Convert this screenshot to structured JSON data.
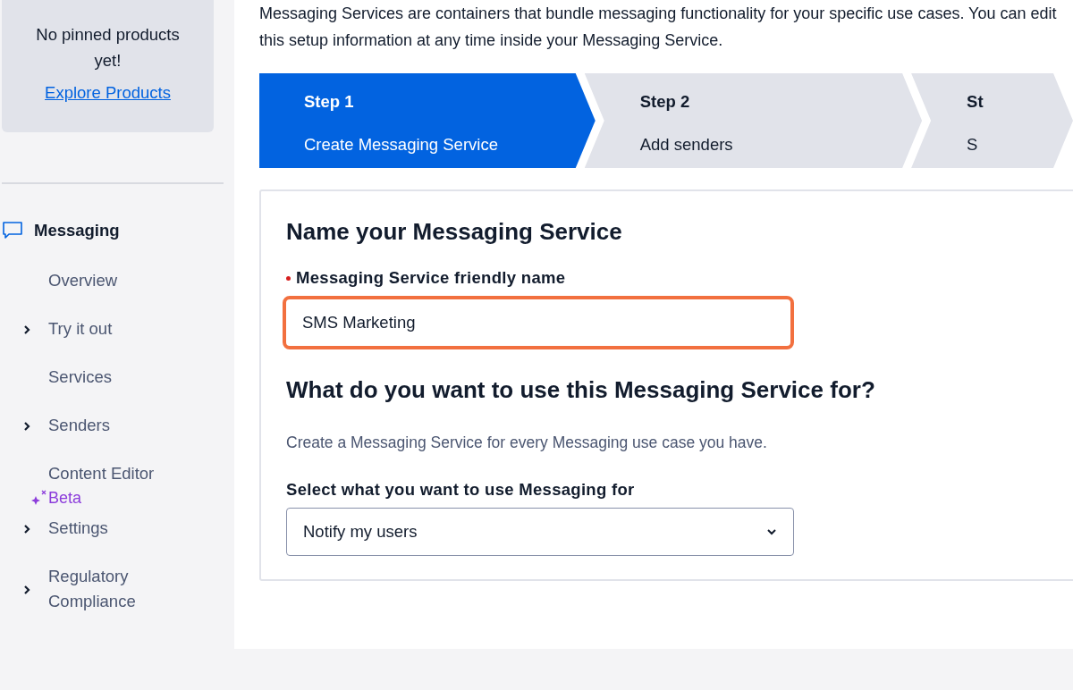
{
  "pinned": {
    "message": "No pinned products yet!",
    "link": "Explore Products"
  },
  "sidebar": {
    "section": "Messaging",
    "items": [
      {
        "label": "Overview",
        "expandable": false
      },
      {
        "label": "Try it out",
        "expandable": true
      },
      {
        "label": "Services",
        "expandable": false
      },
      {
        "label": "Senders",
        "expandable": true
      },
      {
        "label": "Content Editor",
        "expandable": false,
        "badge": "Beta"
      },
      {
        "label": "Settings",
        "expandable": true
      },
      {
        "label": "Regulatory Compliance",
        "expandable": true
      }
    ]
  },
  "intro": "Messaging Services are containers that bundle messaging functionality for your specific use cases. You can edit this setup information at any time inside your Messaging Service.",
  "steps": [
    {
      "title": "Step 1",
      "subtitle": "Create Messaging Service",
      "selected": true
    },
    {
      "title": "Step 2",
      "subtitle": "Add senders",
      "selected": false
    },
    {
      "title": "St",
      "subtitle": "S",
      "selected": false
    }
  ],
  "form": {
    "heading": "Name your Messaging Service",
    "name_field": {
      "label": "Messaging Service friendly name",
      "required": true,
      "value": "SMS Marketing",
      "focused": true
    },
    "use_heading": "What do you want to use this Messaging Service for?",
    "use_text": "Create a Messaging Service for every Messaging use case you have.",
    "use_select": {
      "label": "Select what you want to use Messaging for",
      "value": "Notify my users"
    }
  }
}
